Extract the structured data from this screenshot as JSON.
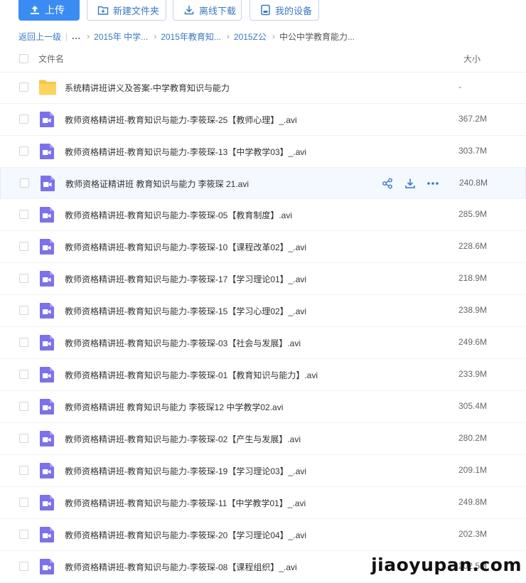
{
  "toolbar": {
    "upload_label": "上传",
    "new_folder_label": "新建文件夹",
    "offline_download_label": "离线下载",
    "my_devices_label": "我的设备"
  },
  "breadcrumb": {
    "back": "返回上一级",
    "ellipsis": "...",
    "items": [
      "2015年 中学...",
      "2015年教育知...",
      "2015Z公"
    ],
    "current": "中公中学教育能力..."
  },
  "columns": {
    "name": "文件名",
    "size": "大小"
  },
  "files": [
    {
      "type": "folder",
      "name": "系统精讲班讲义及答案-中学教育知识与能力",
      "size": "-"
    },
    {
      "type": "video",
      "name": "教师资格精讲班-教育知识与能力-李筱琛-25【教师心理】_.avi",
      "size": "367.2M"
    },
    {
      "type": "video",
      "name": "教师资格精讲班-教育知识与能力-李筱琛-13【中学教学03】_.avi",
      "size": "303.7M"
    },
    {
      "type": "video",
      "name": "教师资格证精讲班 教育知识与能力 李筱琛 21.avi",
      "size": "240.8M"
    },
    {
      "type": "video",
      "name": "教师资格精讲班-教育知识与能力-李筱琛-05【教育制度】.avi",
      "size": "285.9M"
    },
    {
      "type": "video",
      "name": "教师资格精讲班-教育知识与能力-李筱琛-10【课程改革02】_.avi",
      "size": "228.6M"
    },
    {
      "type": "video",
      "name": "教师资格精讲班-教育知识与能力-李筱琛-17【学习理论01】_.avi",
      "size": "218.9M"
    },
    {
      "type": "video",
      "name": "教师资格精讲班-教育知识与能力-李筱琛-15【学习心理02】_.avi",
      "size": "238.9M"
    },
    {
      "type": "video",
      "name": "教师资格精讲班-教育知识与能力-李筱琛-03【社会与发展】.avi",
      "size": "249.6M"
    },
    {
      "type": "video",
      "name": "教师资格精讲班-教育知识与能力-李筱琛-01【教育知识与能力】.avi",
      "size": "233.9M"
    },
    {
      "type": "video",
      "name": "教师资格精讲班 教育知识与能力 李筱琛12 中学教学02.avi",
      "size": "305.4M"
    },
    {
      "type": "video",
      "name": "教师资格精讲班-教育知识与能力-李筱琛-02【产生与发展】.avi",
      "size": "280.2M"
    },
    {
      "type": "video",
      "name": "教师资格精讲班-教育知识与能力-李筱琛-19【学习理论03】_.avi",
      "size": "209.1M"
    },
    {
      "type": "video",
      "name": "教师资格精讲班-教育知识与能力-李筱琛-11【中学教学01】_.avi",
      "size": "249.8M"
    },
    {
      "type": "video",
      "name": "教师资格精讲班-教育知识与能力-李筱琛-20【学习理论04】_.avi",
      "size": "202.3M"
    },
    {
      "type": "video",
      "name": "教师资格精讲班-教育知识与能力-李筱琛-08【课程组织】_.avi",
      "size": "202.5M"
    }
  ],
  "hover_row_index": 3,
  "row_actions": [
    "share-icon",
    "download-icon",
    "more-icon"
  ],
  "watermark": "jiaoyupan.com",
  "colors": {
    "primary": "#3b8cf2",
    "link": "#3b78c2",
    "folder": "#f7c544",
    "video": "#7b72e9"
  }
}
